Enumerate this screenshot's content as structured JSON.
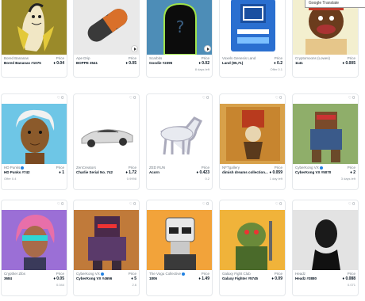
{
  "tooltip": "Google Translate",
  "cards": [
    {
      "id": "a1",
      "collection": "Bored Bananas",
      "name": "Bored Bananas #1075",
      "price_label": "Price",
      "price": "0.04",
      "footer_left": "",
      "footer_right": "",
      "like": ""
    },
    {
      "id": "a2",
      "collection": "Ape Drip",
      "name": "BOPPE 3541",
      "price_label": "Price",
      "price": "0.05",
      "footer_left": "",
      "footer_right": "",
      "like": ""
    },
    {
      "id": "a3",
      "collection": "Scarbits",
      "name": "Goodie #2395",
      "price_label": "Price",
      "price": "0.02",
      "footer_left": "",
      "footer_right": "8 days left",
      "like": ""
    },
    {
      "id": "a4",
      "collection": "Voxels Genesis Land",
      "name": "Land (95,71)",
      "price_label": "Price",
      "price": "0.2",
      "footer_left": "Offer 0.1",
      "footer_right": "",
      "like": ""
    },
    {
      "id": "a5",
      "collection": "Cryptomoons (Lowes)",
      "name": "1141",
      "price_label": "Price",
      "price": "0.005",
      "footer_left": "",
      "footer_right": "",
      "like": ""
    },
    {
      "id": "b1",
      "collection": "HD Punks",
      "name": "HD Punks #742",
      "price_label": "Price",
      "price": "1",
      "footer_left": "Offer 0.4",
      "footer_right": "",
      "like": "0"
    },
    {
      "id": "b2",
      "collection": "ZenCreators",
      "name": "Charlie Serial No. 742",
      "price_label": "Price",
      "price": "1.72",
      "footer_left": "",
      "footer_right": "0.9998",
      "like": "0"
    },
    {
      "id": "b3",
      "collection": "ZED RUN",
      "name": "Acorn",
      "price_label": "Price",
      "price": "0.423",
      "footer_left": "",
      "footer_right": "0.2",
      "like": "0"
    },
    {
      "id": "b4",
      "collection": "NFTgallery",
      "name": "dimish dreams collection...",
      "price_label": "Price",
      "price": "0.059",
      "footer_left": "",
      "footer_right": "1 day left",
      "like": "0"
    },
    {
      "id": "b5",
      "collection": "CyberKong VX",
      "name": "CyberKong VX #5070",
      "price_label": "Price",
      "price": "2",
      "footer_left": "",
      "footer_right": "3 days left",
      "like": "0"
    },
    {
      "id": "c1",
      "collection": "Crypther Zibs",
      "name": "3684",
      "price_label": "Price",
      "price": "0.05",
      "footer_left": "",
      "footer_right": "0.044",
      "like": "0"
    },
    {
      "id": "c2",
      "collection": "CyberKong VX",
      "name": "CyberKong VX #4656",
      "price_label": "Price",
      "price": "5",
      "footer_left": "",
      "footer_right": "2.6",
      "like": "0"
    },
    {
      "id": "c3",
      "collection": "The Vogu Collective",
      "name": "1806",
      "price_label": "Price",
      "price": "1.49",
      "footer_left": "",
      "footer_right": "",
      "like": "0"
    },
    {
      "id": "c4",
      "collection": "Galaxy Fight Club",
      "name": "Galaxy Fighter #5745",
      "price_label": "Price",
      "price": "0.09",
      "footer_left": "",
      "footer_right": "",
      "like": "0"
    },
    {
      "id": "c5",
      "collection": "Headz",
      "name": "Headz #3880",
      "price_label": "Price",
      "price": "0.088",
      "footer_left": "",
      "footer_right": "0.071",
      "like": "0"
    }
  ]
}
